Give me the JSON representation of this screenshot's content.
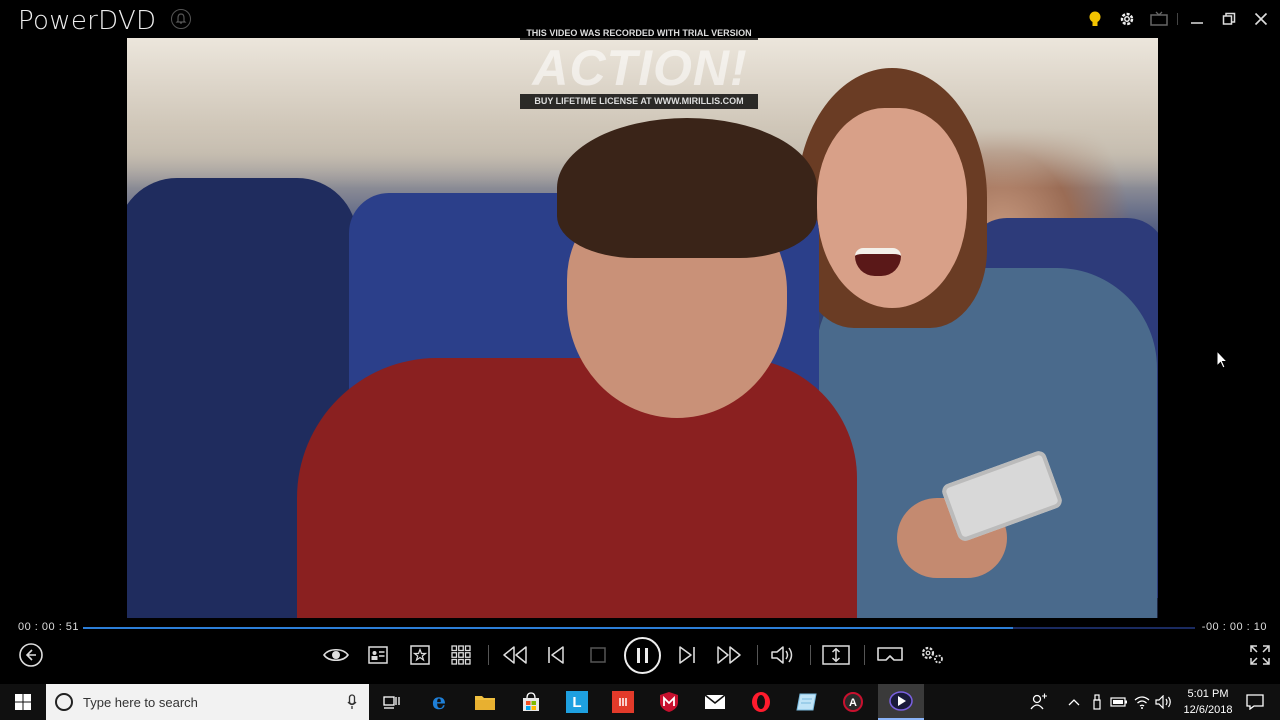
{
  "app": {
    "title": "PowerDVD"
  },
  "watermark": {
    "top": "THIS VIDEO WAS RECORDED WITH TRIAL VERSION",
    "logo": "ACTION!",
    "bottom": "BUY LIFETIME LICENSE AT WWW.MIRILLIS.COM"
  },
  "titlebar_icons": [
    "notification-bell-icon",
    "lightbulb-icon",
    "settings-gear-icon",
    "tv-mode-icon",
    "minimize-icon",
    "restore-icon",
    "close-icon"
  ],
  "playback": {
    "elapsed": "00 : 00 : 51",
    "remaining": "-00 : 00 : 10",
    "progress": 0.836
  },
  "controls": [
    "back-icon",
    "eye-icon",
    "info-card-icon",
    "bookmark-star-icon",
    "grid-icon",
    "rewind-icon",
    "previous-icon",
    "stop-icon",
    "pause-icon",
    "next-icon",
    "fast-forward-icon",
    "volume-icon",
    "aspect-ratio-icon",
    "vr-headset-icon",
    "advanced-settings-icon",
    "fullscreen-icon"
  ],
  "taskbar": {
    "search_placeholder": "Type here to search",
    "apps": [
      "task-view-icon",
      "edge-icon",
      "file-explorer-icon",
      "store-icon",
      "l-app-icon",
      "red-app-icon",
      "mcafee-icon",
      "mail-icon",
      "opera-icon",
      "notepad-icon",
      "action-recorder-icon",
      "powerdvd-icon"
    ],
    "clock_time": "5:01 PM",
    "clock_date": "12/6/2018",
    "colors": {
      "edge": "#1e7fd8",
      "explorer": "#f0c040",
      "l_app": "#1ea0e0",
      "red_app": "#e23a2a",
      "opera": "#ff1b2d"
    }
  }
}
